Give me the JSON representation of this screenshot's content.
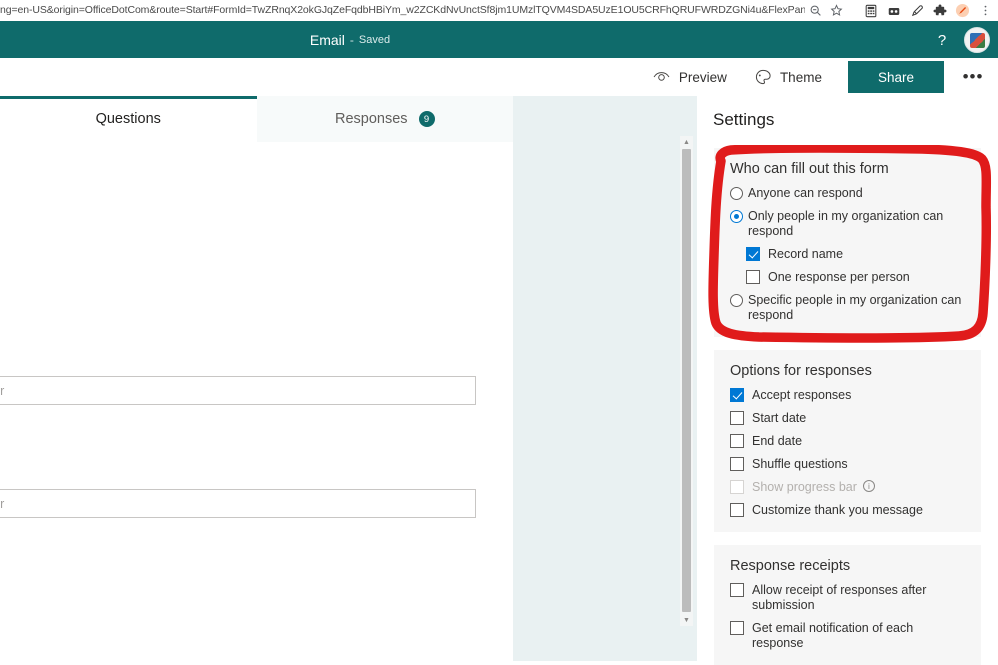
{
  "browser": {
    "url": "ng=en-US&origin=OfficeDotCom&route=Start#FormId=TwZRnqX2okGJqZeFqdbHBiYm_w2ZCKdNvUnctSf8jm1UMzlTQVM4SDA5UzE1OU5CRFhQRUFWRDZGNi4u&FlexPane=Settings",
    "icons": {
      "zoom": "zoom-out-icon",
      "bookmark": "star-icon",
      "ext_1": "calculator-extension-icon",
      "ext_2": "split-screen-icon",
      "ext_3": "eyedropper-extension-icon",
      "ext_4": "puzzle-extensions-icon",
      "ext_5": "orange-extension-icon",
      "menu": "kebab-menu-icon"
    }
  },
  "header": {
    "title": "Email",
    "dash": "-",
    "saved_status": "Saved",
    "help_glyph": "?",
    "avatar_name": "user-avatar"
  },
  "command_bar": {
    "preview_label": "Preview",
    "theme_label": "Theme",
    "share_label": "Share",
    "more_glyph": "•••"
  },
  "tabs": [
    {
      "label": "Questions",
      "active": true,
      "badge": null
    },
    {
      "label": "Responses",
      "active": false,
      "badge": "9"
    }
  ],
  "form": {
    "answer_placeholder_1": "nswer",
    "answer_placeholder_2": "nswer",
    "scroll_up_glyph": "▲",
    "scroll_down_glyph": "▼"
  },
  "settings": {
    "title": "Settings",
    "who_can_fill": {
      "heading": "Who can fill out this form",
      "options": [
        {
          "label": "Anyone can respond",
          "checked": false
        },
        {
          "label": "Only people in my organization can respond",
          "checked": true
        },
        {
          "label": "Specific people in my organization can respond",
          "checked": false
        }
      ],
      "suboptions": [
        {
          "label": "Record name",
          "checked": true
        },
        {
          "label": "One response per person",
          "checked": false
        }
      ]
    },
    "options_for_responses": {
      "heading": "Options for responses",
      "items": [
        {
          "label": "Accept responses",
          "checked": true,
          "disabled": false,
          "info": false
        },
        {
          "label": "Start date",
          "checked": false,
          "disabled": false,
          "info": false
        },
        {
          "label": "End date",
          "checked": false,
          "disabled": false,
          "info": false
        },
        {
          "label": "Shuffle questions",
          "checked": false,
          "disabled": false,
          "info": false
        },
        {
          "label": "Show progress bar",
          "checked": false,
          "disabled": true,
          "info": true
        },
        {
          "label": "Customize thank you message",
          "checked": false,
          "disabled": false,
          "info": false
        }
      ]
    },
    "response_receipts": {
      "heading": "Response receipts",
      "items": [
        {
          "label": "Allow receipt of responses after submission",
          "checked": false
        },
        {
          "label": "Get email notification of each response",
          "checked": false
        }
      ]
    }
  },
  "annotation": {
    "shape": "hand-drawn-rounded-rectangle",
    "color": "#e01b1b",
    "target": "who-can-fill-out-this-form-card"
  },
  "colors": {
    "brand_teal": "#0f6b6b",
    "accent_blue": "#0078d4",
    "canvas_blue": "#e9f1f2",
    "card_gray": "#f6f6f6",
    "annotation_red": "#e01b1b"
  }
}
